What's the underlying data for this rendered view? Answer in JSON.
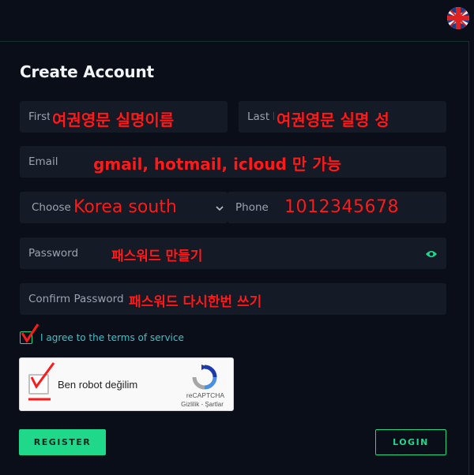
{
  "header": {
    "language_flag": "uk-flag-icon"
  },
  "form": {
    "title": "Create Account",
    "first_name": {
      "placeholder": "First",
      "annotation": "여권영문 실명이름"
    },
    "last_name": {
      "placeholder": "Last N",
      "annotation": "여권영문 실명 성"
    },
    "email": {
      "placeholder": "Email",
      "annotation": "gmail, hotmail, icloud 만 가능"
    },
    "country": {
      "placeholder": "Choose",
      "annotation": "Korea south"
    },
    "phone": {
      "placeholder": "Phone",
      "annotation": "1012345678"
    },
    "password": {
      "placeholder": "Password",
      "annotation": "패스워드 만들기"
    },
    "confirm_password": {
      "placeholder": "Confirm Password",
      "annotation": "패스워드 다시한번 쓰기"
    },
    "agree_label": "I agree to the terms of service",
    "captcha": {
      "label": "Ben robot değilim",
      "brand": "reCAPTCHA",
      "links": "Gizlilik - Şartlar"
    },
    "register_label": "REGISTER",
    "login_label": "LOGIN"
  },
  "colors": {
    "background": "#0a0e18",
    "field": "#141a26",
    "accent": "#1fd88a",
    "annotation": "#ff1a1a",
    "link": "#3fc2c8"
  }
}
